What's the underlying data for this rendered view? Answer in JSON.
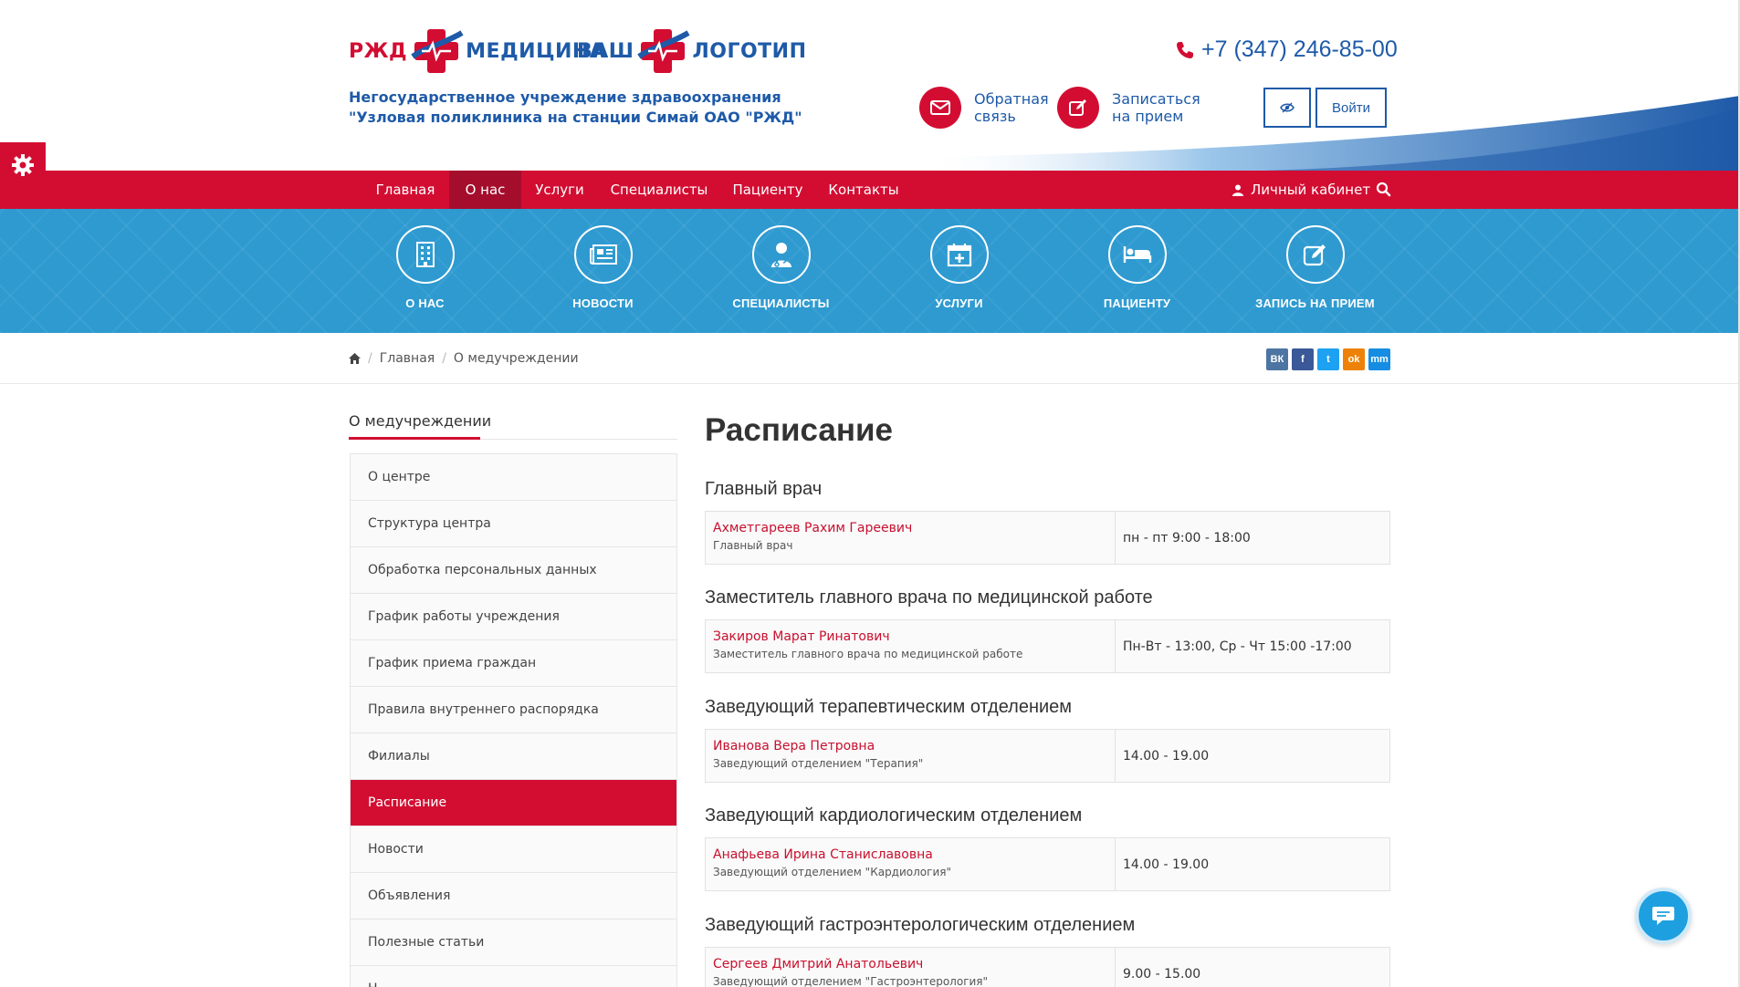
{
  "header": {
    "logo1": {
      "left": "РЖД",
      "right": "МЕДИЦИНА"
    },
    "logo2": {
      "left": "ВАШ",
      "right": "ЛОГОТИП"
    },
    "org_name": "Негосударственное учреждение здравоохранения \"Узловая поликлиника на станции Симай ОАО \"РЖД\"",
    "phone": "+7 (347) 246-85-00",
    "feedback_label": "Обратная связь",
    "appointment_label": "Записаться на прием",
    "login_label": "Войти",
    "colors": {
      "red": "#d30d32",
      "blue": "#1e5aa8",
      "band": "#2e9ad0"
    }
  },
  "nav": {
    "items": [
      {
        "label": "Главная"
      },
      {
        "label": "О нас"
      },
      {
        "label": "Услуги"
      },
      {
        "label": "Специалисты"
      },
      {
        "label": "Пациенту"
      },
      {
        "label": "Контакты"
      }
    ],
    "active": "О нас",
    "cabinet_label": "Личный кабинет"
  },
  "band": {
    "items": [
      {
        "label": "О НАС",
        "icon": "building-icon"
      },
      {
        "label": "НОВОСТИ",
        "icon": "newspaper-icon"
      },
      {
        "label": "СПЕЦИАЛИСТЫ",
        "icon": "doctor-icon"
      },
      {
        "label": "УСЛУГИ",
        "icon": "calendar-plus-icon"
      },
      {
        "label": "ПАЦИЕНТУ",
        "icon": "bed-icon"
      },
      {
        "label": "ЗАПИСЬ НА ПРИЕМ",
        "icon": "edit-icon"
      }
    ]
  },
  "breadcrumb": {
    "home": "Главная",
    "current": "О медучреждении"
  },
  "social": [
    "ВК",
    "f",
    "t",
    "ok",
    "mm"
  ],
  "sidebar": {
    "title": "О медучреждении",
    "items": [
      {
        "label": "О центре"
      },
      {
        "label": "Структура центра"
      },
      {
        "label": "Обработка персональных данных"
      },
      {
        "label": "График работы учреждения"
      },
      {
        "label": "График приема граждан"
      },
      {
        "label": "Правила внутреннего распорядка"
      },
      {
        "label": "Филиалы"
      },
      {
        "label": "Расписание"
      },
      {
        "label": "Новости"
      },
      {
        "label": "Объявления"
      },
      {
        "label": "Полезные статьи"
      },
      {
        "label": "Н"
      }
    ],
    "active": "Расписание"
  },
  "main": {
    "title": "Расписание",
    "sections": [
      {
        "heading": "Главный врач",
        "name": "Ахметгареев Рахим Гареевич",
        "position": "Главный врач",
        "time": "пн - пт 9:00 - 18:00"
      },
      {
        "heading": "Заместитель главного врача по медицинской работе",
        "name": "Закиров Марат Ринатович",
        "position": "Заместитель главного врача по медицинской работе",
        "time": "Пн-Вт - 13:00, Ср - Чт 15:00 -17:00"
      },
      {
        "heading": "Заведующий терапевтическим отделением",
        "name": "Иванова Вера Петровна",
        "position": "Заведующий отделением \"Терапия\"",
        "time": "14.00 - 19.00"
      },
      {
        "heading": "Заведующий кардиологическим отделением",
        "name": "Анафьева Ирина Станиславовна",
        "position": "Заведующий отделением \"Кардиология\"",
        "time": "14.00 - 19.00"
      },
      {
        "heading": "Заведующий гастроэнтерологическим отделением",
        "name": "Сергеев Дмитрий Анатольевич",
        "position": "Заведующий отделением \"Гастроэнтерология\"",
        "time": "9.00 - 15.00"
      }
    ]
  }
}
